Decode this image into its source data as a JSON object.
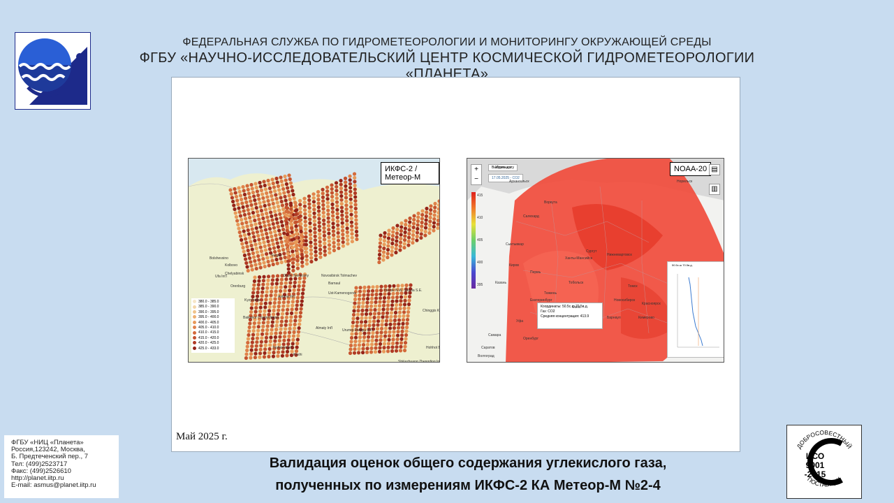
{
  "header": {
    "line1": "ФЕДЕРАЛЬНАЯ СЛУЖБА ПО ГИДРОМЕТЕОРОЛОГИИ И МОНИТОРИНГУ ОКРУЖАЮЩЕЙ СРЕДЫ",
    "line2": "ФГБУ «НАУЧНО-ИССЛЕДОВАТЕЛЬСКИЙ ЦЕНТР КОСМИЧЕСКОЙ ГИДРОМЕТЕОРОЛОГИИ «ПЛАНЕТА»"
  },
  "maps": {
    "left_title": "ИКФС-2 / Метеор-М",
    "right_title": "NOAA-20",
    "left_legend": [
      "380.0 - 385.0",
      "385.0 - 390.0",
      "390.0 - 395.0",
      "395.0 - 400.0",
      "400.0 - 405.0",
      "405.0 - 410.0",
      "410.0 - 415.0",
      "415.0 - 420.0",
      "420.0 - 425.0",
      "425.0 - 433.0"
    ],
    "left_legend_colors": [
      "#f6e6c8",
      "#f3d6a8",
      "#f0c48a",
      "#eeb070",
      "#e89a5a",
      "#e0824a",
      "#d46a3a",
      "#c4522e",
      "#b03a24",
      "#962418"
    ],
    "left_places": [
      "Bolshevsino",
      "Kolbovo",
      "Ufa Int'l",
      "Chelyabinsk",
      "Surgut",
      "Omsk Tsentralny",
      "Novosibirsk Tolmachev",
      "Barnaul",
      "Ust-Kamenogorsk",
      "Astana Int'l",
      "Baikonur Cosmodrome",
      "Almaty Int'l",
      "Urumqi Diwopu Int'l",
      "Chinggis Khaan Int'l",
      "Tashkent Int'l",
      "Kashi",
      "Hohhot Baita Int'l",
      "Shijiazhuang Zhengding Int'l",
      "Kyzylorda",
      "Orenburg",
      "Irkutsk N.W. Shuzla S.E."
    ],
    "right_selector": "Выбрать дату",
    "right_date": "17.05.2025 - CO2",
    "right_colorbar_ticks": [
      "415",
      "410",
      "405",
      "400",
      "395"
    ],
    "right_popup": [
      "Координаты: 50.5с.ш 70.5в.д.",
      "Газ: CO2",
      "Средняя концентрация: 413.9"
    ],
    "right_inset_title": "50.5с.ш 70.5в.д.",
    "right_places": [
      "Норильск",
      "Воркута",
      "Салехард",
      "Сыктывкар",
      "Ханты-Мансийск",
      "Сургут",
      "Нижневартовск",
      "Тобольск",
      "Тюмень",
      "Екатеринбург",
      "Омск",
      "Новосибирск",
      "Томск",
      "Красноярск",
      "Барнаул",
      "Кемерово",
      "Уфа",
      "Оренбург",
      "Казань",
      "Самара",
      "Саратов",
      "Волгоград",
      "Пермь",
      "Киров",
      "Архангельск",
      "Мурманск"
    ]
  },
  "date_label": "Май  2025 г.",
  "contacts": [
    "ФГБУ «НИЦ «Планета»",
    "Россия,123242, Москва,",
    "Б. Предтеченский пер., 7",
    "Тел:   (499)2523717",
    "Факс: (499)2526610",
    "http://planet.iitp.ru",
    "E-mail: asmus@planet.iitp.ru"
  ],
  "caption": {
    "line1": "Валидация оценок общего содержания углекислого газа,",
    "line2": "полученных по измерениям ИКФС-2 КА Метеор-М №2-4"
  },
  "iso": {
    "top": "ДОБРОСОВЕСТНЫЙ",
    "mid1": "ИСО",
    "mid2": "9001",
    "mid3": "-2015",
    "bottom": "ПОСТАВЩИК"
  }
}
